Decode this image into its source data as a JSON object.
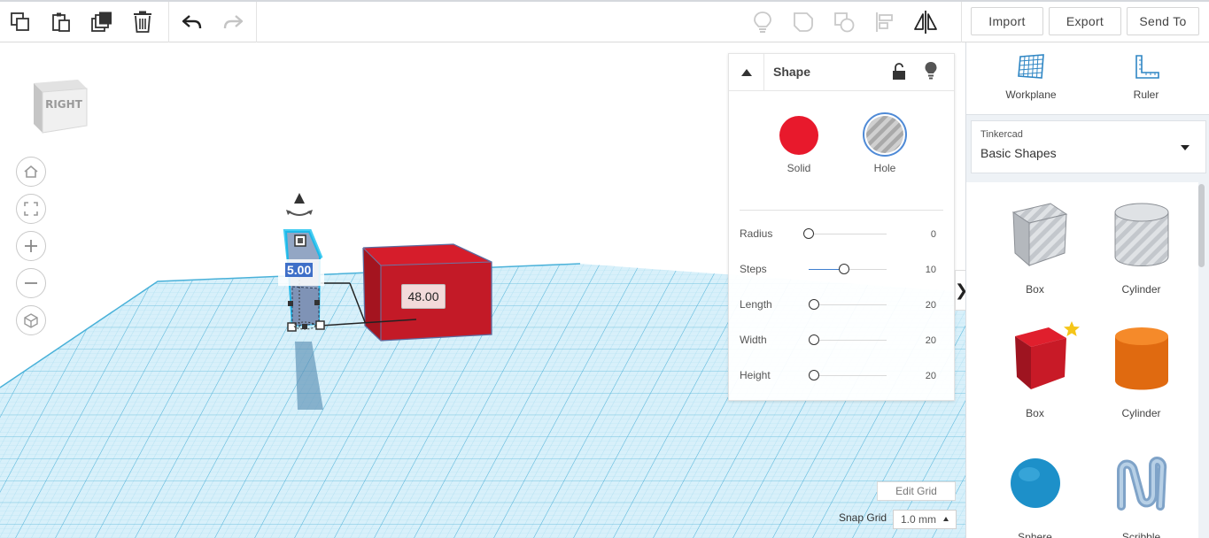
{
  "toolbar": {
    "left_icons": [
      "copy-icon",
      "paste-icon",
      "duplicate-icon",
      "delete-icon",
      "undo-icon",
      "redo-icon"
    ],
    "right_icons": [
      "light-bulb-icon",
      "group-icon",
      "ungroup-icon",
      "align-icon",
      "mirror-icon"
    ],
    "import_label": "Import",
    "export_label": "Export",
    "send_to_label": "Send To"
  },
  "viewcube": {
    "face_label": "RIGHT"
  },
  "nav": {
    "icons": [
      "home-icon",
      "fit-all-icon",
      "zoom-in-icon",
      "zoom-out-icon",
      "ortho-view-icon"
    ]
  },
  "viewport": {
    "height_label": "5.00",
    "distance_label": "48.00"
  },
  "inspector": {
    "title": "Shape",
    "solid_label": "Solid",
    "hole_label": "Hole",
    "colors": {
      "solid": "#e8192c",
      "hole": "#b5b5b5",
      "accent": "#3f7fcf"
    },
    "properties": [
      {
        "name": "Radius",
        "value": "0",
        "fraction": 0.0
      },
      {
        "name": "Steps",
        "value": "10",
        "fraction": 0.45
      },
      {
        "name": "Length",
        "value": "20",
        "fraction": 0.07
      },
      {
        "name": "Width",
        "value": "20",
        "fraction": 0.07
      },
      {
        "name": "Height",
        "value": "20",
        "fraction": 0.07
      }
    ]
  },
  "grid_controls": {
    "edit_grid_label": "Edit Grid",
    "snap_grid_label": "Snap Grid",
    "snap_value": "1.0 mm"
  },
  "panel": {
    "workplane_label": "Workplane",
    "ruler_label": "Ruler",
    "library_caption": "Tinkercad",
    "library_value": "Basic Shapes",
    "shapes": [
      {
        "label": "Box",
        "kind": "hole-box"
      },
      {
        "label": "Cylinder",
        "kind": "hole-cylinder"
      },
      {
        "label": "Box",
        "kind": "box"
      },
      {
        "label": "Cylinder",
        "kind": "cylinder"
      },
      {
        "label": "Sphere",
        "kind": "sphere"
      },
      {
        "label": "Scribble",
        "kind": "scribble"
      }
    ]
  }
}
